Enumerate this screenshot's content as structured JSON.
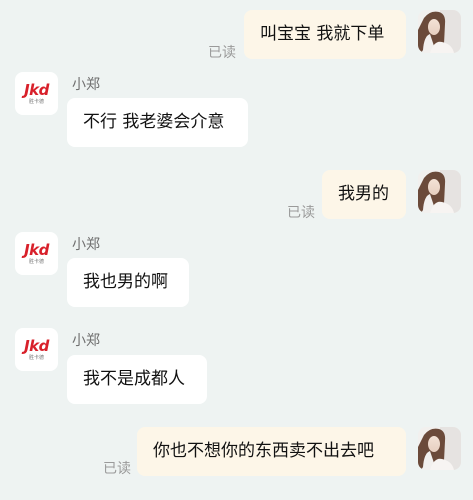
{
  "contact": {
    "name": "小郑",
    "logo_text": "Jkd",
    "logo_sub": "胜卡德"
  },
  "read_label": "已读",
  "messages": [
    {
      "direction": "out",
      "text": "叫宝宝 我就下单",
      "status": "已读"
    },
    {
      "direction": "in",
      "sender": "小郑",
      "text": "不行 我老婆会介意"
    },
    {
      "direction": "out",
      "text": "我男的",
      "status": "已读"
    },
    {
      "direction": "in",
      "sender": "小郑",
      "text": "我也男的啊"
    },
    {
      "direction": "in",
      "sender": "小郑",
      "text": "我不是成都人"
    },
    {
      "direction": "out",
      "text": "你也不想你的东西卖不出去吧",
      "status": "已读"
    }
  ],
  "colors": {
    "background": "#eef3f2",
    "bubble_in": "#ffffff",
    "bubble_out": "#fdf6e8",
    "logo_red": "#d8202a"
  },
  "icons": {
    "user_avatar": "girl-photo-avatar",
    "contact_avatar": "jkd-logo"
  }
}
